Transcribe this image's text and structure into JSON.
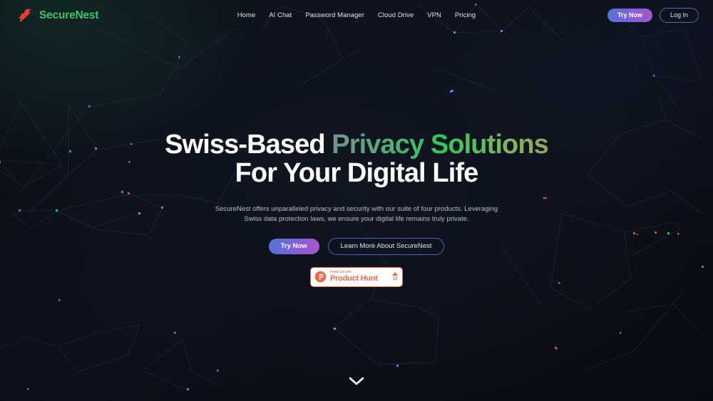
{
  "brand": {
    "name": "SecureNest",
    "logo_icon": "lightning-bolt-icon",
    "name_color": "#3fc46a",
    "logo_color": "#ef3f32"
  },
  "nav": {
    "items": [
      {
        "label": "Home"
      },
      {
        "label": "AI Chat"
      },
      {
        "label": "Password Manager"
      },
      {
        "label": "Cloud Drive"
      },
      {
        "label": "VPN"
      },
      {
        "label": "Pricing"
      }
    ]
  },
  "header_actions": {
    "try_now_label": "Try Now",
    "log_in_label": "Log In",
    "try_now_gradient_from": "#5078d6",
    "try_now_gradient_to": "#a558c7",
    "log_in_border": "#4e6ab8"
  },
  "hero": {
    "headline_line1_plain": "Swiss-Based ",
    "headline_line1_gradient": "Privacy Solutions",
    "headline_line2": "For Your Digital Life",
    "headline_gradient_from": "#76938d",
    "headline_gradient_mid": "#35c657",
    "headline_gradient_to": "#9ba35c",
    "subhead": "SecureNest offers unparalleled privacy and security with our suite of four products. Leveraging Swiss data protection laws, we ensure your digital life remains truly private.",
    "cta_primary_label": "Try Now",
    "cta_secondary_label": "Learn More About SecureNest"
  },
  "product_hunt": {
    "kicker": "FIND US ON",
    "title": "Product Hunt",
    "upvote_count": "13",
    "accent_color": "#f1654a",
    "logo_icon": "product-hunt-icon",
    "arrow_icon": "upvote-triangle-icon"
  },
  "scroll": {
    "icon": "chevron-down-icon"
  },
  "background": {
    "base_color": "#0c1018",
    "node_colors": [
      "#2fa8a0",
      "#c65ac0",
      "#4f7fd8",
      "#3fc46a",
      "#e0564a",
      "#7b61d9"
    ]
  }
}
